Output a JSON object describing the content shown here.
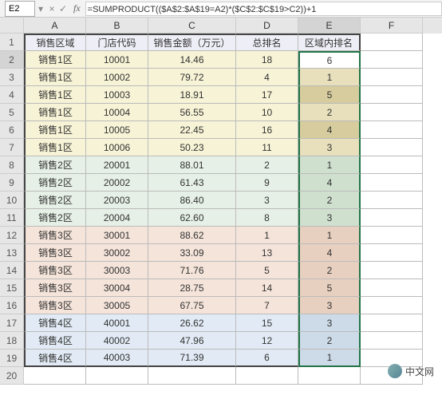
{
  "formula_bar": {
    "name_box": "E2",
    "fx": "fx",
    "formula": "=SUMPRODUCT(($A$2:$A$19=A2)*($C$2:$C$19>C2))+1"
  },
  "columns": [
    "A",
    "B",
    "C",
    "D",
    "E",
    "F"
  ],
  "row_numbers": [
    "1",
    "2",
    "3",
    "4",
    "5",
    "6",
    "7",
    "8",
    "9",
    "10",
    "11",
    "12",
    "13",
    "14",
    "15",
    "16",
    "17",
    "18",
    "19",
    "20"
  ],
  "headers": {
    "A": "销售区域",
    "B": "门店代码",
    "C": "销售金额（万元）",
    "D": "总排名",
    "E": "区域内排名"
  },
  "rows": [
    {
      "a": "销售1区",
      "b": "10001",
      "c": "14.46",
      "d": "18",
      "e": "6",
      "cls": "c-y",
      "ecls": "c-yd"
    },
    {
      "a": "销售1区",
      "b": "10002",
      "c": "79.72",
      "d": "4",
      "e": "1",
      "cls": "c-y",
      "ecls": "c-ye"
    },
    {
      "a": "销售1区",
      "b": "10003",
      "c": "18.91",
      "d": "17",
      "e": "5",
      "cls": "c-y",
      "ecls": "c-yd"
    },
    {
      "a": "销售1区",
      "b": "10004",
      "c": "56.55",
      "d": "10",
      "e": "2",
      "cls": "c-y",
      "ecls": "c-ye"
    },
    {
      "a": "销售1区",
      "b": "10005",
      "c": "22.45",
      "d": "16",
      "e": "4",
      "cls": "c-y",
      "ecls": "c-yd"
    },
    {
      "a": "销售1区",
      "b": "10006",
      "c": "50.23",
      "d": "11",
      "e": "3",
      "cls": "c-y",
      "ecls": "c-ye"
    },
    {
      "a": "销售2区",
      "b": "20001",
      "c": "88.01",
      "d": "2",
      "e": "1",
      "cls": "c-g",
      "ecls": "c-gd"
    },
    {
      "a": "销售2区",
      "b": "20002",
      "c": "61.43",
      "d": "9",
      "e": "4",
      "cls": "c-g",
      "ecls": "c-gd"
    },
    {
      "a": "销售2区",
      "b": "20003",
      "c": "86.40",
      "d": "3",
      "e": "2",
      "cls": "c-g",
      "ecls": "c-gd"
    },
    {
      "a": "销售2区",
      "b": "20004",
      "c": "62.60",
      "d": "8",
      "e": "3",
      "cls": "c-g",
      "ecls": "c-gd"
    },
    {
      "a": "销售3区",
      "b": "30001",
      "c": "88.62",
      "d": "1",
      "e": "1",
      "cls": "c-o",
      "ecls": "c-od"
    },
    {
      "a": "销售3区",
      "b": "30002",
      "c": "33.09",
      "d": "13",
      "e": "4",
      "cls": "c-o",
      "ecls": "c-od"
    },
    {
      "a": "销售3区",
      "b": "30003",
      "c": "71.76",
      "d": "5",
      "e": "2",
      "cls": "c-o",
      "ecls": "c-od"
    },
    {
      "a": "销售3区",
      "b": "30004",
      "c": "28.75",
      "d": "14",
      "e": "5",
      "cls": "c-o",
      "ecls": "c-od"
    },
    {
      "a": "销售3区",
      "b": "30005",
      "c": "67.75",
      "d": "7",
      "e": "3",
      "cls": "c-o",
      "ecls": "c-od"
    },
    {
      "a": "销售4区",
      "b": "40001",
      "c": "26.62",
      "d": "15",
      "e": "3",
      "cls": "c-b",
      "ecls": "c-bd"
    },
    {
      "a": "销售4区",
      "b": "40002",
      "c": "47.96",
      "d": "12",
      "e": "2",
      "cls": "c-b",
      "ecls": "c-bd"
    },
    {
      "a": "销售4区",
      "b": "40003",
      "c": "71.39",
      "d": "6",
      "e": "1",
      "cls": "c-b",
      "ecls": "c-bd"
    }
  ],
  "watermark": "中文网"
}
